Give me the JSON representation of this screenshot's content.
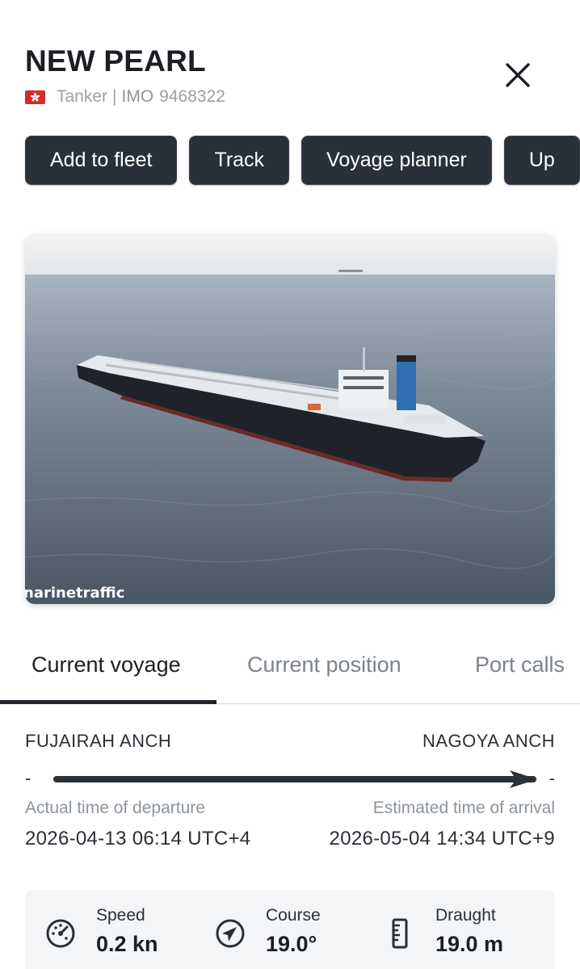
{
  "vessel": {
    "name": "NEW PEARL",
    "type": "Tanker",
    "separator": "|",
    "imo_label": "IMO",
    "imo_number": "9468322",
    "flag_icon": "hong-kong-flag-icon"
  },
  "actions": [
    {
      "label": "Add to fleet"
    },
    {
      "label": "Track"
    },
    {
      "label": "Voyage planner"
    },
    {
      "label": "Up"
    }
  ],
  "photo": {
    "watermark": "narinetraffic"
  },
  "tabs": [
    {
      "label": "Current voyage",
      "active": true
    },
    {
      "label": "Current position",
      "active": false
    },
    {
      "label": "Port calls",
      "active": false
    }
  ],
  "voyage": {
    "origin": "FUJAIRAH ANCH",
    "destination": "NAGOYA ANCH",
    "origin_dash": "-",
    "destination_dash": "-",
    "departure_label": "Actual time of departure",
    "departure_value": "2026-04-13 06:14 UTC+4",
    "arrival_label": "Estimated time of arrival",
    "arrival_value": "2026-05-04 14:34 UTC+9"
  },
  "stats": [
    {
      "label": "Speed",
      "value": "0.2 kn",
      "icon": "speedometer-icon"
    },
    {
      "label": "Course",
      "value": "19.0°",
      "icon": "compass-icon"
    },
    {
      "label": "Draught",
      "value": "19.0 m",
      "icon": "ruler-icon"
    }
  ],
  "colors": {
    "button_bg": "#2a3037",
    "tab_indicator": "#1f252b",
    "flag_red": "#d62a2a"
  }
}
